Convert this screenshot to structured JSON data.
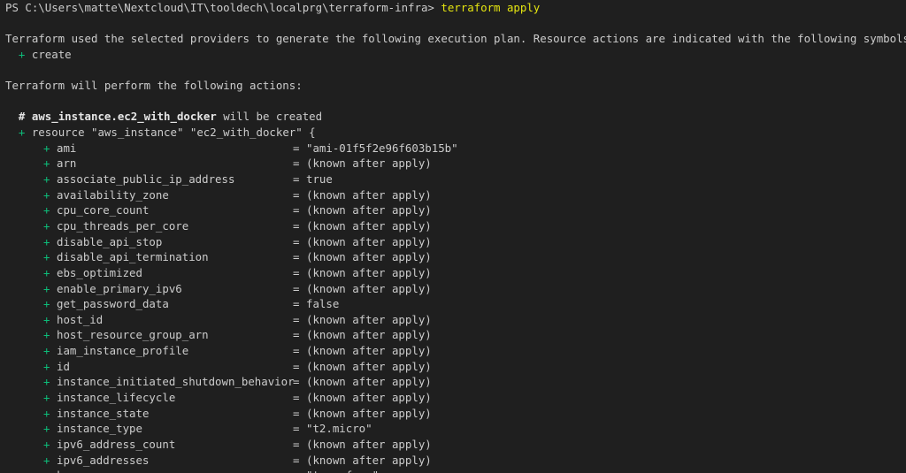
{
  "prompt": {
    "ps_path": "PS C:\\Users\\matte\\Nextcloud\\IT\\tooldech\\localprg\\terraform-infra> ",
    "command": "terraform apply"
  },
  "intro_line": "Terraform used the selected providers to generate the following execution plan. Resource actions are indicated with the following symbols:",
  "legend": {
    "symbol": "+",
    "label": "create"
  },
  "actions_line": "Terraform will perform the following actions:",
  "resource_comment": {
    "hash": "#",
    "name": "aws_instance.ec2_with_docker",
    "suffix": " will be created"
  },
  "resource_decl": {
    "symbol": "+",
    "text": " resource \"aws_instance\" \"ec2_with_docker\" {"
  },
  "attributes": [
    {
      "name": "ami",
      "value": "\"ami-01f5f2e96f603b15b\""
    },
    {
      "name": "arn",
      "value": "(known after apply)"
    },
    {
      "name": "associate_public_ip_address",
      "value": "true"
    },
    {
      "name": "availability_zone",
      "value": "(known after apply)"
    },
    {
      "name": "cpu_core_count",
      "value": "(known after apply)"
    },
    {
      "name": "cpu_threads_per_core",
      "value": "(known after apply)"
    },
    {
      "name": "disable_api_stop",
      "value": "(known after apply)"
    },
    {
      "name": "disable_api_termination",
      "value": "(known after apply)"
    },
    {
      "name": "ebs_optimized",
      "value": "(known after apply)"
    },
    {
      "name": "enable_primary_ipv6",
      "value": "(known after apply)"
    },
    {
      "name": "get_password_data",
      "value": "false"
    },
    {
      "name": "host_id",
      "value": "(known after apply)"
    },
    {
      "name": "host_resource_group_arn",
      "value": "(known after apply)"
    },
    {
      "name": "iam_instance_profile",
      "value": "(known after apply)"
    },
    {
      "name": "id",
      "value": "(known after apply)"
    },
    {
      "name": "instance_initiated_shutdown_behavior",
      "value": "(known after apply)"
    },
    {
      "name": "instance_lifecycle",
      "value": "(known after apply)"
    },
    {
      "name": "instance_state",
      "value": "(known after apply)"
    },
    {
      "name": "instance_type",
      "value": "\"t2.micro\""
    },
    {
      "name": "ipv6_address_count",
      "value": "(known after apply)"
    },
    {
      "name": "ipv6_addresses",
      "value": "(known after apply)"
    },
    {
      "name": "key_name",
      "value": "\"terraform\""
    }
  ],
  "attr_symbol": "+",
  "attr_eq": "=",
  "colors": {
    "background": "#1f1f1f",
    "foreground": "#cccccc",
    "command": "#e5e510",
    "plus": "#0dbc79"
  }
}
